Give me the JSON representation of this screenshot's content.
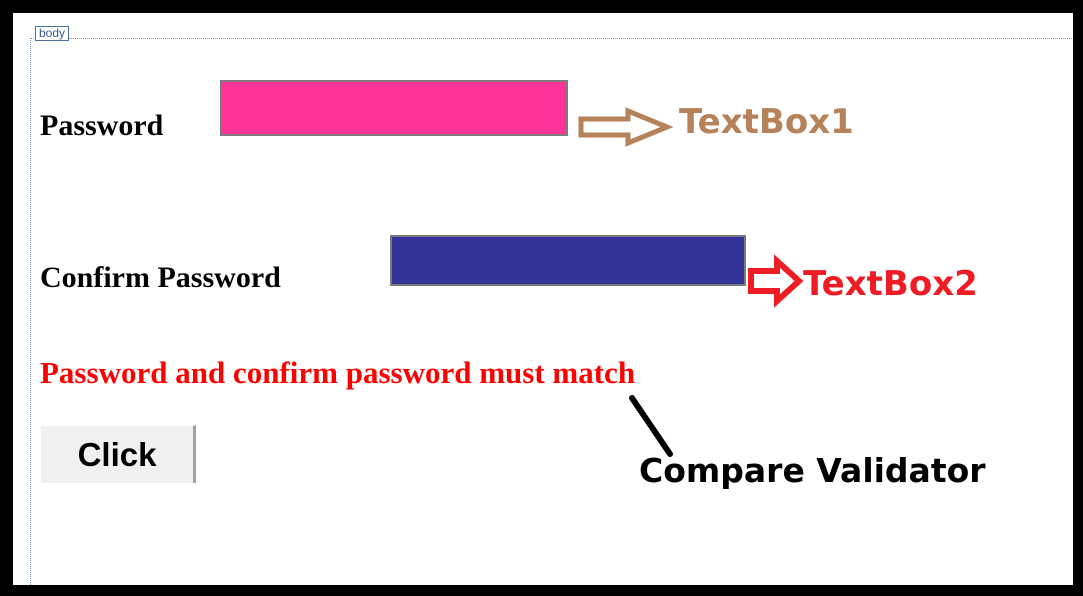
{
  "designer": {
    "body_tag": "body"
  },
  "form": {
    "password_label": "Password",
    "confirm_label": "Confirm Password",
    "validator_message": "Password and confirm password must match",
    "button_label": "Click"
  },
  "annotations": {
    "textbox1": "TextBox1",
    "textbox2": "TextBox2",
    "compare_validator": "Compare Validator"
  },
  "colors": {
    "textbox1_fill": "#ff3399",
    "textbox2_fill": "#333399",
    "textbox1_annotation": "#b5825a",
    "textbox2_annotation": "#ee1c24",
    "validator_text": "#ff0000",
    "pointer_line": "#000000"
  },
  "icons": {
    "textbox1_arrow": "right-arrow-outline-icon",
    "textbox2_arrow": "right-arrow-outline-icon",
    "validator_pointer": "pointer-line"
  }
}
